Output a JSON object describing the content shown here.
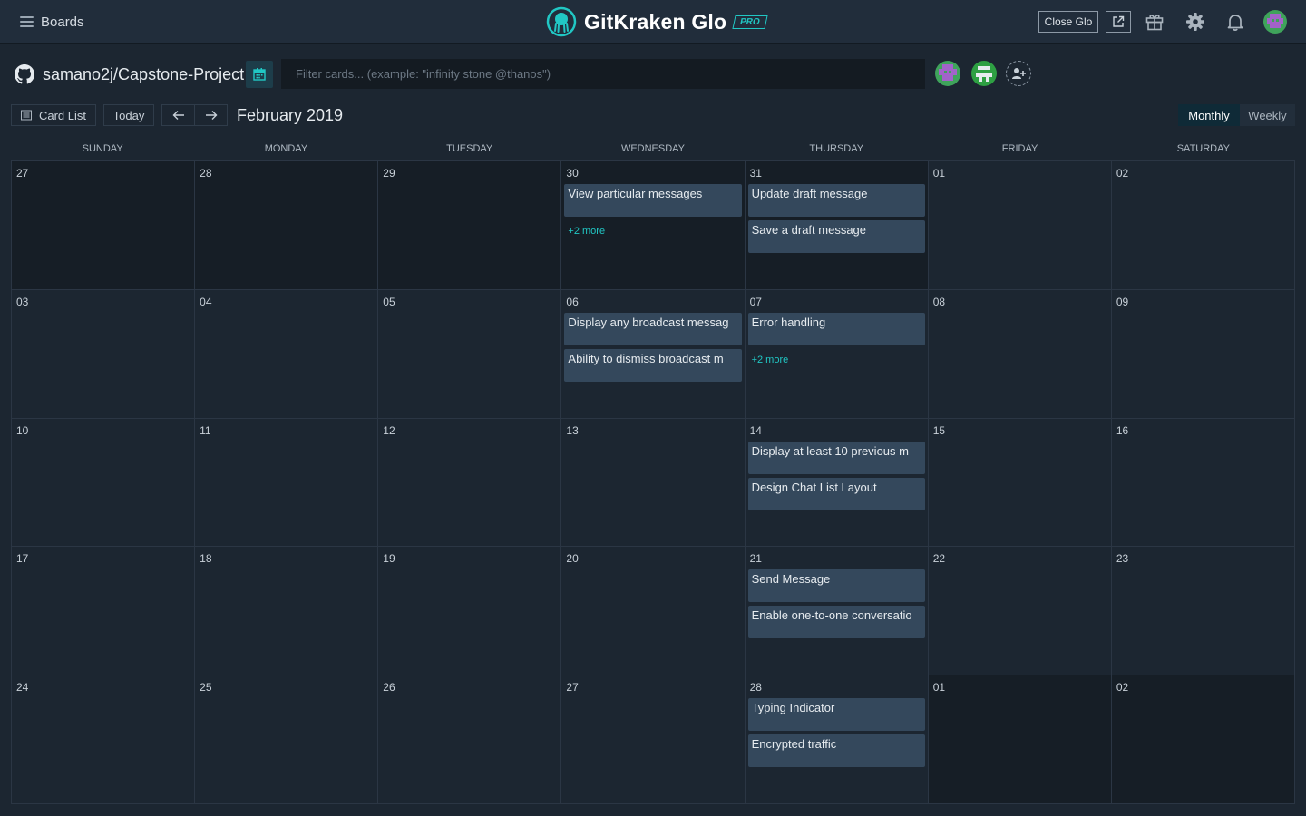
{
  "topbar": {
    "boards_label": "Boards",
    "brand_name": "GitKraken Glo",
    "brand_badge": "PRO",
    "close_glo_label": "Close Glo",
    "icons": [
      "external-link-icon",
      "gift-icon",
      "gear-icon",
      "bell-icon",
      "user-avatar"
    ]
  },
  "board": {
    "repo_name": "samano2j/Capstone-Project",
    "filter_placeholder": "Filter cards... (example: \"infinity stone @thanos\")"
  },
  "controls": {
    "card_list_label": "Card List",
    "today_label": "Today",
    "month_label": "February 2019",
    "view_options": [
      "Monthly",
      "Weekly"
    ],
    "active_view": "Monthly"
  },
  "calendar": {
    "weekdays": [
      "SUNDAY",
      "MONDAY",
      "TUESDAY",
      "WEDNESDAY",
      "THURSDAY",
      "FRIDAY",
      "SATURDAY"
    ],
    "weeks": [
      [
        {
          "day": "27",
          "outside": true,
          "cards": []
        },
        {
          "day": "28",
          "outside": true,
          "cards": []
        },
        {
          "day": "29",
          "outside": true,
          "cards": []
        },
        {
          "day": "30",
          "outside": true,
          "cards": [
            "View particular messages"
          ],
          "more": "+2 more"
        },
        {
          "day": "31",
          "outside": true,
          "cards": [
            "Update draft message",
            "Save a draft message"
          ]
        },
        {
          "day": "01",
          "outside": false,
          "cards": []
        },
        {
          "day": "02",
          "outside": false,
          "cards": []
        }
      ],
      [
        {
          "day": "03",
          "outside": false,
          "cards": []
        },
        {
          "day": "04",
          "outside": false,
          "cards": []
        },
        {
          "day": "05",
          "outside": false,
          "cards": []
        },
        {
          "day": "06",
          "outside": false,
          "cards": [
            "Display any broadcast messag",
            "Ability to dismiss broadcast m"
          ]
        },
        {
          "day": "07",
          "outside": false,
          "cards": [
            "Error handling"
          ],
          "more": "+2 more"
        },
        {
          "day": "08",
          "outside": false,
          "cards": []
        },
        {
          "day": "09",
          "outside": false,
          "cards": []
        }
      ],
      [
        {
          "day": "10",
          "outside": false,
          "cards": []
        },
        {
          "day": "11",
          "outside": false,
          "cards": []
        },
        {
          "day": "12",
          "outside": false,
          "cards": []
        },
        {
          "day": "13",
          "outside": false,
          "cards": []
        },
        {
          "day": "14",
          "outside": false,
          "cards": [
            "Display at least 10 previous m",
            "Design Chat List Layout"
          ]
        },
        {
          "day": "15",
          "outside": false,
          "cards": []
        },
        {
          "day": "16",
          "outside": false,
          "cards": []
        }
      ],
      [
        {
          "day": "17",
          "outside": false,
          "cards": []
        },
        {
          "day": "18",
          "outside": false,
          "cards": []
        },
        {
          "day": "19",
          "outside": false,
          "cards": []
        },
        {
          "day": "20",
          "outside": false,
          "cards": []
        },
        {
          "day": "21",
          "outside": false,
          "cards": [
            "Send Message",
            "Enable one-to-one conversatio"
          ]
        },
        {
          "day": "22",
          "outside": false,
          "cards": []
        },
        {
          "day": "23",
          "outside": false,
          "cards": []
        }
      ],
      [
        {
          "day": "24",
          "outside": false,
          "cards": []
        },
        {
          "day": "25",
          "outside": false,
          "cards": []
        },
        {
          "day": "26",
          "outside": false,
          "cards": []
        },
        {
          "day": "27",
          "outside": false,
          "cards": []
        },
        {
          "day": "28",
          "outside": false,
          "cards": [
            "Typing Indicator",
            "Encrypted traffic"
          ]
        },
        {
          "day": "01",
          "outside": true,
          "cards": []
        },
        {
          "day": "02",
          "outside": true,
          "cards": []
        }
      ]
    ]
  },
  "colors": {
    "accent": "#21c7c4",
    "card_bg": "#34485c",
    "page_bg": "#1c2631",
    "topbar_bg": "#212d3b"
  }
}
